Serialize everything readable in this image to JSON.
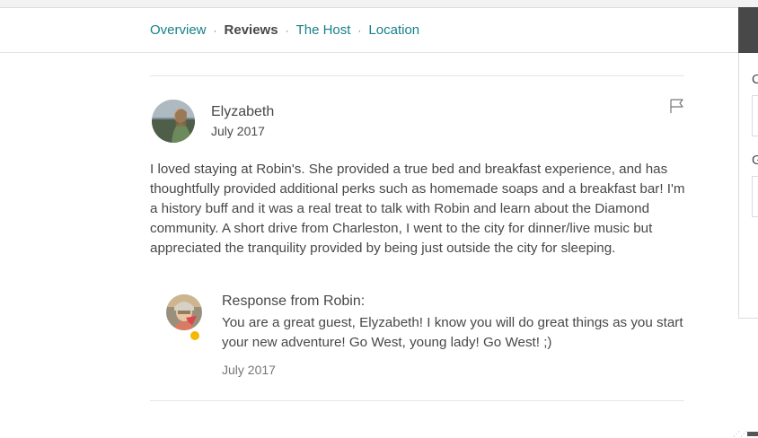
{
  "nav": {
    "items": [
      "Overview",
      "Reviews",
      "The Host",
      "Location"
    ],
    "separator": "·",
    "active": "Reviews"
  },
  "review": {
    "reviewer_name": "Elyzabeth",
    "date": "July 2017",
    "text": "I loved staying at Robin's. She provided a true bed and breakfast experience, and has thoughtfully provided additional perks such as homemade soaps and a breakfast bar! I'm a history buff and it was a real treat to talk with Robin and learn about the Diamond community. A short drive from Charleston, I went to the city for dinner/live music but appreciated the tranquility provided by being just outside the city for sleeping.",
    "flag_icon": "flag-icon"
  },
  "response": {
    "title": "Response from Robin:",
    "text": "You are a great guest, Elyzabeth! I know you will do great things as you start your new adventure! Go West, young lady! Go West! ;)",
    "date": "July 2017"
  },
  "booking_panel": {
    "label_1": "C",
    "label_2": "G"
  },
  "colors": {
    "link": "#16828a",
    "text": "#484848",
    "muted": "#767676",
    "divider": "#e4e4e4",
    "superhost_badge": "#f5b800"
  }
}
